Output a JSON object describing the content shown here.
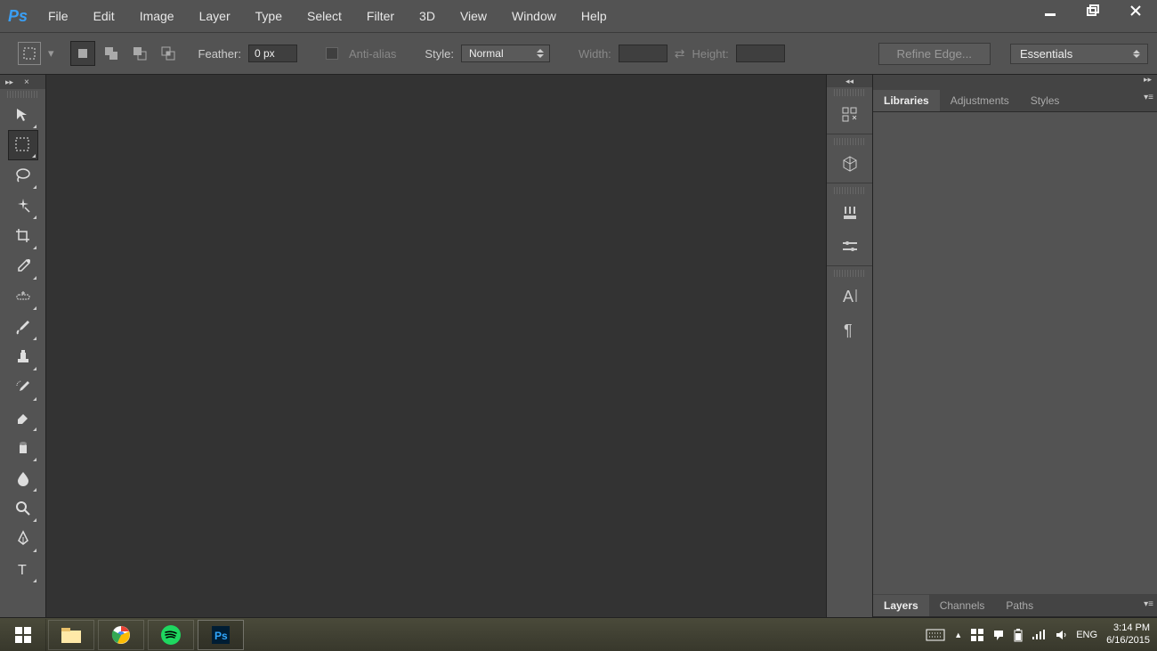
{
  "menubar": [
    "File",
    "Edit",
    "Image",
    "Layer",
    "Type",
    "Select",
    "Filter",
    "3D",
    "View",
    "Window",
    "Help"
  ],
  "options": {
    "feather_label": "Feather:",
    "feather_value": "0 px",
    "antialias_label": "Anti-alias",
    "style_label": "Style:",
    "style_value": "Normal",
    "width_label": "Width:",
    "height_label": "Height:",
    "refine": "Refine Edge...",
    "workspace": "Essentials"
  },
  "panel_tabs_top": [
    "Libraries",
    "Adjustments",
    "Styles"
  ],
  "panel_tabs_bottom": [
    "Layers",
    "Channels",
    "Paths"
  ],
  "tray": {
    "lang": "ENG",
    "time": "3:14 PM",
    "date": "6/16/2015"
  }
}
